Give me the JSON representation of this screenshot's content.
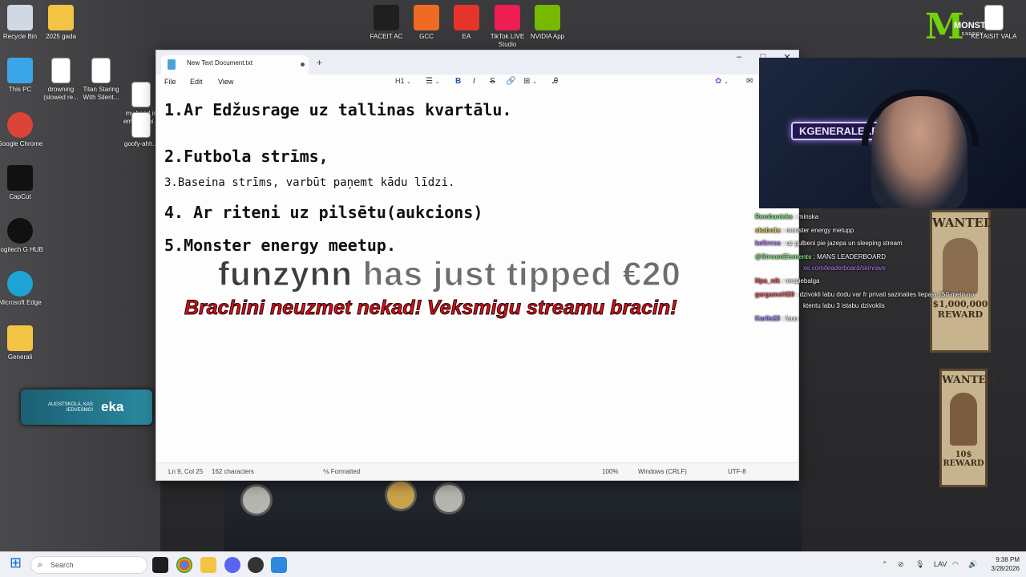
{
  "desktop": {
    "icons": [
      {
        "label": "Recycle Bin",
        "icon": "recycle-bin-icon",
        "color": "#cfd8e3"
      },
      {
        "label": "2025 gada",
        "icon": "folder-icon",
        "color": "#f3c343"
      },
      {
        "label": "This PC",
        "icon": "monitor-icon",
        "color": "#3aa5e8"
      },
      {
        "label": "drowning (slowed re...",
        "icon": "video-file-icon",
        "color": "#ffffff"
      },
      {
        "label": "Titan Staring With Silent...",
        "icon": "video-file-icon",
        "color": "#ffffff"
      },
      {
        "label": "my head is empty - thi...",
        "icon": "video-file-icon",
        "color": "#ffffff"
      },
      {
        "label": "Google Chrome",
        "icon": "chrome-icon",
        "color": "#db4437"
      },
      {
        "label": "goofy-ahh...",
        "icon": "video-file-icon",
        "color": "#ffffff"
      },
      {
        "label": "CapCut",
        "icon": "capcut-icon",
        "color": "#111111"
      },
      {
        "label": "Logitech G HUB",
        "icon": "logitech-icon",
        "color": "#111111"
      },
      {
        "label": "Microsoft Edge",
        "icon": "edge-icon",
        "color": "#1fa3d6"
      },
      {
        "label": "Generali",
        "icon": "folder-icon",
        "color": "#f3c343"
      },
      {
        "label": "FACEIT AC",
        "icon": "faceit-icon",
        "color": "#1f1f1f"
      },
      {
        "label": "GCC",
        "icon": "gcc-icon",
        "color": "#ef6b23"
      },
      {
        "label": "EA",
        "icon": "ea-icon",
        "color": "#e5352a"
      },
      {
        "label": "TikTok LIVE Studio",
        "icon": "tiktok-icon",
        "color": "#ee1d52"
      },
      {
        "label": "NVIDIA App",
        "icon": "nvidia-icon",
        "color": "#76b900"
      },
      {
        "label": "KETAISIT VALA",
        "icon": "document-icon",
        "color": "#ffffff"
      }
    ],
    "widget_text_1": "AUGSTSKOLA, KAS IEDVESMO!",
    "widget_text_2": "eka"
  },
  "notepad": {
    "tab_title": "New Text Document.txt",
    "new_tab": "+",
    "window_controls": [
      "–",
      "□",
      "✕"
    ],
    "menu": [
      "File",
      "Edit",
      "View"
    ],
    "heading_select": "H1",
    "toolbar": {
      "bold": "B",
      "italic": "I",
      "strike": "S"
    },
    "lines": [
      "1.Ar Edžusrage uz tallinas kvartālu.",
      "2.Futbola strīms,",
      "3.Baseina strīms, varbūt paņemt kādu līdzi.",
      "4. Ar riteni uz pilsētu(aukcions)",
      "5.Monster energy meetup."
    ],
    "status": {
      "position": "Ln 9, Col 25",
      "chars": "162 characters",
      "format": "Formatted",
      "zoom": "100%",
      "line_ending": "Windows (CRLF)",
      "encoding": "UTF-8"
    }
  },
  "overlay": {
    "tipper": "funzynn",
    "tip_text": "has just tipped €20",
    "message": "Brachini neuzmet nekad! Veksmigu streamu bracin!"
  },
  "webcam": {
    "nameplate": "KGENERALEXE"
  },
  "brand": {
    "logo_mark": "M",
    "logo_word": "MONSTER",
    "logo_sub": "ENERGY"
  },
  "chat": [
    {
      "user": "Rembanieks",
      "text": ": minska",
      "color": "#7ee07e"
    },
    {
      "user": "skabo1s",
      "text": ": monster energy metupp",
      "color": "#e0c84a"
    },
    {
      "user": "kefirrrss",
      "text": ": uz gulbeni pie jazepa un sleeping stream",
      "color": "#b57cff"
    },
    {
      "user": "@StreamElements",
      "text": ": MANS LEADERBOARD",
      "color": "#7ee07e"
    },
    {
      "user": "",
      "text": "xe.com/leaderboard/skinrave",
      "color": "#b57cff"
    },
    {
      "user": "Npa_nik",
      "text": ": vecpiebalga",
      "color": "#e05a5a"
    },
    {
      "user": "gargamel420",
      "text": ": dzivokli labu dodu var fr privati sazinaties liepaja 150 metri no",
      "color": "#e05a5a"
    },
    {
      "user": "",
      "text": "ktentu labu 3 istabu dzivoklis",
      "color": "#ffffff"
    },
    {
      "user": "Karlis23",
      "text": ": fuuu",
      "color": "#8a8aff"
    }
  ],
  "posters": {
    "top_text": "WANTED",
    "top_reward": "$1,000,000 REWARD",
    "bottom_text": "WANTED",
    "bottom_reward": "10$ REWARD"
  },
  "taskbar": {
    "search_placeholder": "Search",
    "language": "LAV",
    "time": "9:38 PM",
    "date": "3/28/2026"
  }
}
